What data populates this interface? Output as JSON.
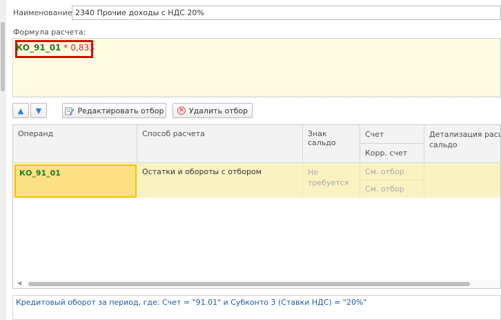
{
  "name_field": {
    "label": "Наименование:",
    "value": "2340 Прочие доходы с НДС 20%"
  },
  "formula": {
    "label": "Формула расчета:",
    "operand": "КО_91_01",
    "operator": "*",
    "number": "0,833",
    "highlight_color": "#e00000"
  },
  "toolbar": {
    "move_up_icon": "arrow-up-icon",
    "move_down_icon": "arrow-down-icon",
    "edit_filter_label": "Редактировать отбор",
    "delete_filter_label": "Удалить отбор"
  },
  "table": {
    "columns": {
      "operand": "Операнд",
      "method": "Способ расчета",
      "balance_sign": "Знак сальдо",
      "account": "Счет",
      "corr_account": "Корр. счет",
      "detail_line1": "Детализация расши",
      "detail_line2": "сальдо"
    },
    "rows": [
      {
        "operand": "КО_91_01",
        "method": "Остатки и обороты с отбором",
        "balance_sign_line1": "Не",
        "balance_sign_line2": "требуется",
        "account": "См. отбор",
        "corr_account": "См. отбор",
        "detail": ""
      }
    ]
  },
  "description": "Кредитовый оборот за период, где: Счет = \"91.01\" и Субконто 3 (Ставки НДС) = \"20%\"",
  "colors": {
    "formula_background": "#fdfbe1",
    "selected_row": "#fbf2c2",
    "selected_cell": "#fbe184",
    "operand_text": "#1f7a1f",
    "formula_number": "#cc2222",
    "description_text": "#1e5aa0"
  }
}
